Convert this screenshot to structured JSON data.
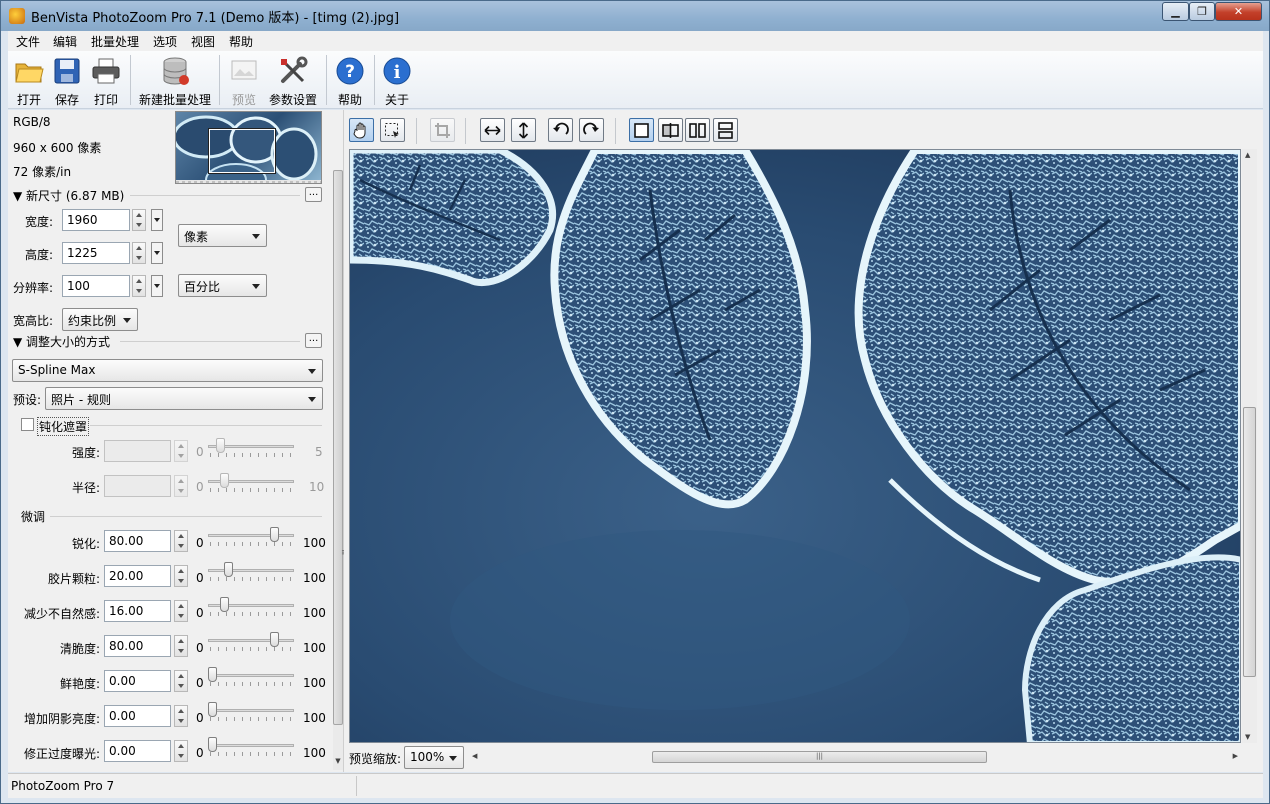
{
  "window": {
    "title": "BenVista PhotoZoom Pro 7.1 (Demo 版本) - [timg (2).jpg]"
  },
  "menu": [
    "文件",
    "编辑",
    "批量处理",
    "选项",
    "视图",
    "帮助"
  ],
  "toolbar": {
    "open": "打开",
    "save": "保存",
    "print": "打印",
    "batch": "新建批量处理",
    "preview": "预览",
    "settings": "参数设置",
    "help": "帮助",
    "about": "关于"
  },
  "image_info": {
    "mode": "RGB/8",
    "size": "960 x 600 像素",
    "resolution": "72 像素/in"
  },
  "new_size": {
    "header": "▼ 新尺寸 (6.87 MB)",
    "width_label": "宽度:",
    "width_value": "1960",
    "height_label": "高度:",
    "height_value": "1225",
    "unit": "像素",
    "resolution_label": "分辨率:",
    "resolution_value": "100",
    "res_unit": "百分比",
    "aspect_label": "宽高比:",
    "aspect_value": "约束比例"
  },
  "resize_method": {
    "header": "▼ 调整大小的方式",
    "method": "S-Spline Max",
    "preset_label": "预设:",
    "preset": "照片 - 规则"
  },
  "unsharp": {
    "label": "钝化遮罩",
    "checked": false,
    "strength_label": "强度:",
    "strength_min": "0",
    "strength_max": "5",
    "strength_level": 0.1,
    "radius_label": "半径:",
    "radius_min": "0",
    "radius_max": "10",
    "radius_level": 0.15
  },
  "finetune": {
    "header": "微调",
    "items": [
      {
        "label": "锐化:",
        "value": "80.00",
        "min": "0",
        "max": "100",
        "level": 0.8
      },
      {
        "label": "胶片颗粒:",
        "value": "20.00",
        "min": "0",
        "max": "100",
        "level": 0.2
      },
      {
        "label": "减少不自然感:",
        "value": "16.00",
        "min": "0",
        "max": "100",
        "level": 0.16
      },
      {
        "label": "清脆度:",
        "value": "80.00",
        "min": "0",
        "max": "100",
        "level": 0.8
      },
      {
        "label": "鲜艳度:",
        "value": "0.00",
        "min": "0",
        "max": "100",
        "level": 0
      },
      {
        "label": "增加阴影亮度:",
        "value": "0.00",
        "min": "0",
        "max": "100",
        "level": 0
      },
      {
        "label": "修正过度曝光:",
        "value": "0.00",
        "min": "0",
        "max": "100",
        "level": 0
      }
    ]
  },
  "preview": {
    "zoom_label": "预览缩放:",
    "zoom_value": "100%"
  },
  "statusbar": {
    "text": "PhotoZoom Pro 7"
  },
  "colors": {
    "accent": "#3c6fa6",
    "titlebar": "#9bb8d6",
    "frost_dark": "#1f3d63",
    "frost_light": "#c8e2f2"
  }
}
